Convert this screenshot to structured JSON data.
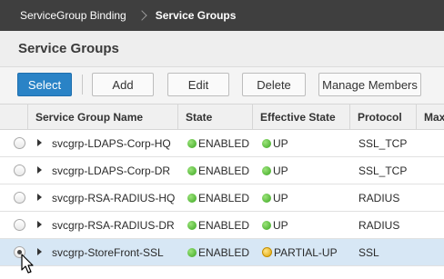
{
  "breadcrumb": {
    "parent": "ServiceGroup Binding",
    "current": "Service Groups"
  },
  "title": "Service Groups",
  "toolbar": {
    "select": "Select",
    "add": "Add",
    "edit": "Edit",
    "delete": "Delete",
    "manage_members": "Manage Members"
  },
  "columns": {
    "name": "Service Group Name",
    "state": "State",
    "effective_state": "Effective State",
    "protocol": "Protocol",
    "max": "Max"
  },
  "rows": [
    {
      "name": "svcgrp-LDAPS-Corp-HQ",
      "state": "ENABLED",
      "effective_state": "UP",
      "protocol": "SSL_TCP",
      "selected": false
    },
    {
      "name": "svcgrp-LDAPS-Corp-DR",
      "state": "ENABLED",
      "effective_state": "UP",
      "protocol": "SSL_TCP",
      "selected": false
    },
    {
      "name": "svcgrp-RSA-RADIUS-HQ",
      "state": "ENABLED",
      "effective_state": "UP",
      "protocol": "RADIUS",
      "selected": false
    },
    {
      "name": "svcgrp-RSA-RADIUS-DR",
      "state": "ENABLED",
      "effective_state": "UP",
      "protocol": "RADIUS",
      "selected": false
    },
    {
      "name": "svcgrp-StoreFront-SSL",
      "state": "ENABLED",
      "effective_state": "PARTIAL-UP",
      "protocol": "SSL",
      "selected": true
    }
  ],
  "colors": {
    "accent": "#2a83c6",
    "status_up": "#3aa520",
    "status_partial": "#e0a400",
    "selected_row": "#d7e7f5"
  },
  "icons": {
    "status_up": "green-dot-icon",
    "status_partial": "partial-up-icon",
    "expander": "expand-arrow-icon",
    "breadcrumb_separator": "chevron-right-icon"
  }
}
